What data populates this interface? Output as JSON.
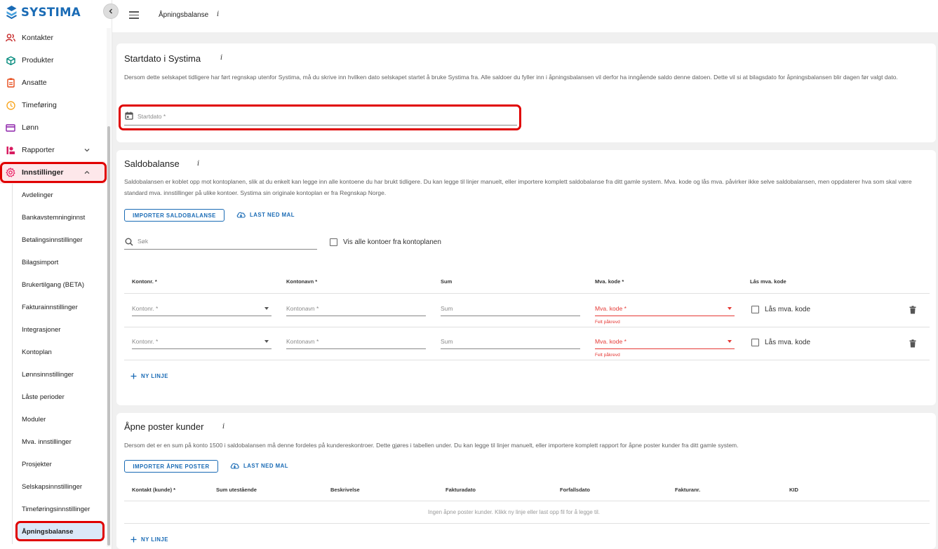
{
  "app": {
    "brand": "SYSTIMA"
  },
  "header": {
    "title": "Åpningsbalanse",
    "info": "i"
  },
  "sidebar": {
    "items": [
      {
        "label": "Kontakter",
        "icon": "contacts-icon"
      },
      {
        "label": "Produkter",
        "icon": "product-box-icon"
      },
      {
        "label": "Ansatte",
        "icon": "badge-icon"
      },
      {
        "label": "Timeføring",
        "icon": "clock-icon"
      },
      {
        "label": "Lønn",
        "icon": "payment-card-icon"
      },
      {
        "label": "Rapporter",
        "icon": "report-icon"
      },
      {
        "label": "Innstillinger",
        "icon": "settings-gear-icon"
      }
    ],
    "sub_items": [
      "Avdelinger",
      "Bankavstemninginnst",
      "Betalingsinnstillinger",
      "Bilagsimport",
      "Brukertilgang (BETA)",
      "Fakturainnstillinger",
      "Integrasjoner",
      "Kontoplan",
      "Lønnsinnstillinger",
      "Låste perioder",
      "Moduler",
      "Mva. innstillinger",
      "Prosjekter",
      "Selskapsinnstillinger",
      "Timeføringsinnstillinger",
      "Åpningsbalanse"
    ]
  },
  "startdato": {
    "title": "Startdato i Systima",
    "info": "i",
    "description": "Dersom dette selskapet tidligere har ført regnskap utenfor Systima, må du skrive inn hvilken dato selskapet startet å bruke Systima fra. Alle saldoer du fyller inn i åpningsbalansen vil derfor ha inngående saldo denne datoen. Dette vil si at bilagsdato for åpningsbalansen blir dagen før valgt dato.",
    "field_placeholder": "Startdato *"
  },
  "saldobalanse": {
    "title": "Saldobalanse",
    "info": "i",
    "description": "Saldobalansen er koblet opp mot kontoplanen, slik at du enkelt kan legge inn alle kontoene du har brukt tidligere. Du kan legge til linjer manuelt, eller importere komplett saldobalanse fra ditt gamle system. Mva. kode og lås mva. påvirker ikke selve saldobalansen, men oppdaterer hva som skal være standard mva. innstillinger på ulike kontoer. Systima sin originale kontoplan er fra Regnskap Norge.",
    "import_btn": "IMPORTER SALDOBALANSE",
    "download_btn": "LAST NED MAL",
    "search_placeholder": "Søk",
    "show_all_label": "Vis alle kontoer fra kontoplanen",
    "columns": [
      "Kontonr. *",
      "Kontonavn *",
      "Sum",
      "Mva. kode *",
      "Lås mva. kode"
    ],
    "rows": [
      {
        "kontonr": "Kontonr. *",
        "kontonavn": "Kontonavn *",
        "sum": "Sum",
        "mva": "Mva. kode *",
        "error": "Felt påkrevd",
        "lock": "Lås mva. kode"
      },
      {
        "kontonr": "Kontonr. *",
        "kontonavn": "Kontonavn *",
        "sum": "Sum",
        "mva": "Mva. kode *",
        "error": "Felt påkrevd",
        "lock": "Lås mva. kode"
      }
    ],
    "new_line": "NY LINJE"
  },
  "apne_poster": {
    "title": "Åpne poster kunder",
    "info": "i",
    "description": "Dersom det er en sum på konto 1500 i saldobalansen må denne fordeles på kundereskontroer. Dette gjøres i tabellen under. Du kan legge til linjer manuelt, eller importere komplett rapport for åpne poster kunder fra ditt gamle system.",
    "import_btn": "IMPORTER ÅPNE POSTER",
    "download_btn": "LAST NED MAL",
    "columns": [
      "Kontakt (kunde) *",
      "Sum utestående",
      "Beskrivelse",
      "Fakturadato",
      "Forfallsdato",
      "Fakturanr.",
      "KID"
    ],
    "empty_message": "Ingen åpne poster kunder. Klikk ny linje eller last opp fil for å legge til.",
    "new_line": "NY LINJE"
  },
  "colors": {
    "accent": "#1a6bb5",
    "error": "#e53935",
    "highlight": "#e00000"
  }
}
